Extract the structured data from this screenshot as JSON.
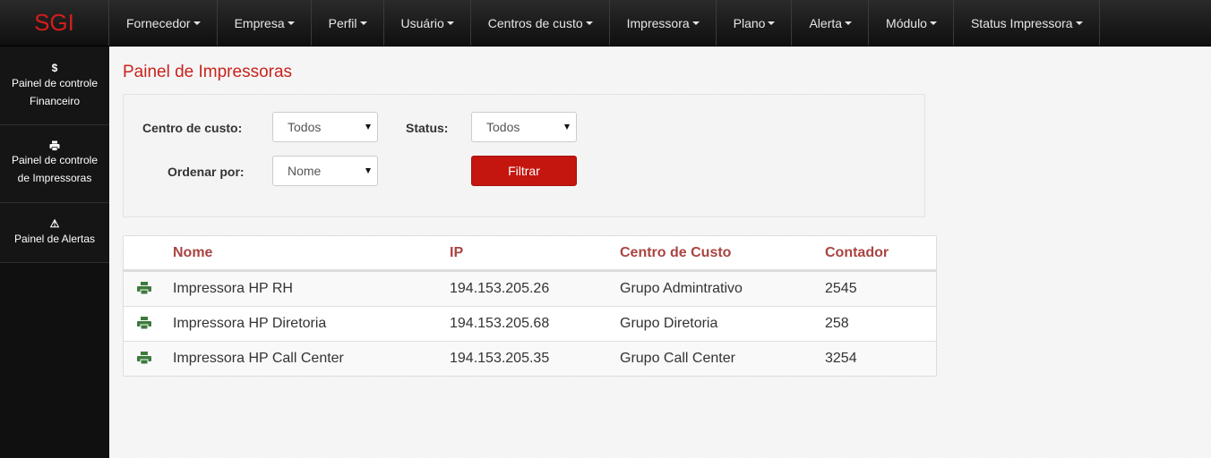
{
  "brand": "SGI",
  "nav": [
    {
      "label": "Fornecedor"
    },
    {
      "label": "Empresa"
    },
    {
      "label": "Perfil"
    },
    {
      "label": "Usuário"
    },
    {
      "label": "Centros de custo"
    },
    {
      "label": "Impressora"
    },
    {
      "label": "Plano"
    },
    {
      "label": "Alerta"
    },
    {
      "label": "Módulo"
    },
    {
      "label": "Status Impressora"
    }
  ],
  "sidebar": {
    "items": [
      {
        "icon": "$",
        "icon_name": "dollar-icon",
        "line1": "Painel de controle",
        "line2": "Financeiro"
      },
      {
        "icon": "🖶",
        "icon_name": "printer-icon",
        "line1": "Painel de controle",
        "line2": "de Impressoras"
      },
      {
        "icon": "⚠",
        "icon_name": "alert-icon",
        "line1": "Painel de Alertas",
        "line2": ""
      }
    ]
  },
  "page": {
    "title": "Painel de Impressoras"
  },
  "filters": {
    "cost_center_label": "Centro de custo:",
    "cost_center_value": "Todos",
    "status_label": "Status:",
    "status_value": "Todos",
    "order_label": "Ordenar por:",
    "order_value": "Nome",
    "filter_button": "Filtrar"
  },
  "table": {
    "headers": {
      "name": "Nome",
      "ip": "IP",
      "cost_center": "Centro de Custo",
      "counter": "Contador"
    },
    "rows": [
      {
        "name": "Impressora HP RH",
        "ip": "194.153.205.26",
        "cost_center": "Grupo Admintrativo",
        "counter": "2545"
      },
      {
        "name": "Impressora HP Diretoria",
        "ip": "194.153.205.68",
        "cost_center": "Grupo Diretoria",
        "counter": "258"
      },
      {
        "name": "Impressora HP Call Center",
        "ip": "194.153.205.35",
        "cost_center": "Grupo Call Center",
        "counter": "3254"
      }
    ]
  },
  "colors": {
    "brand": "#d51c1c",
    "accent": "#c4150f",
    "header_text": "#a94442",
    "printer_icon": "#3d7a3d"
  }
}
